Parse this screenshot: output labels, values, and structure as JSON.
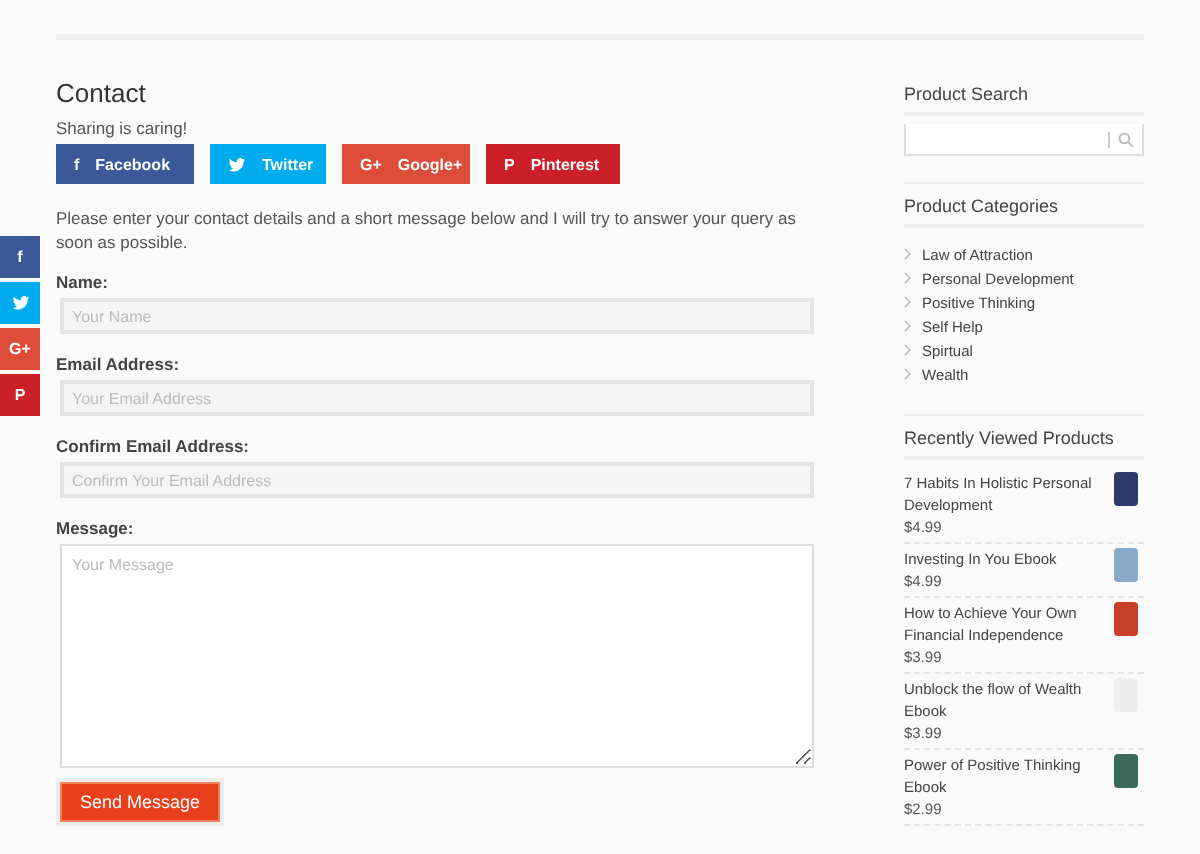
{
  "floating_share": [
    {
      "kind": "facebook",
      "icon": "f",
      "color": "#3b5998"
    },
    {
      "kind": "twitter",
      "color": "#00aced"
    },
    {
      "kind": "googleplus",
      "icon": "G+",
      "color": "#dd4b39"
    },
    {
      "kind": "pinterest",
      "icon": "P",
      "color": "#cb2027"
    }
  ],
  "contact": {
    "title": "Contact",
    "sharing_label": "Sharing is caring!",
    "share_buttons": [
      {
        "kind": "facebook",
        "icon": "f",
        "label": "Facebook",
        "color": "#3b5998"
      },
      {
        "kind": "twitter",
        "label": "Twitter",
        "color": "#00aced"
      },
      {
        "kind": "googleplus",
        "icon": "G+",
        "label": "Google+",
        "color": "#dd4b39"
      },
      {
        "kind": "pinterest",
        "icon": "P",
        "label": "Pinterest",
        "color": "#cb2027"
      }
    ],
    "intro": "Please enter your contact details and a short message below and I will try to answer your query as soon as possible.",
    "fields": [
      {
        "kind": "input",
        "label": "Name:",
        "placeholder": "Your Name"
      },
      {
        "kind": "input",
        "label": "Email Address:",
        "placeholder": "Your Email Address"
      },
      {
        "kind": "input",
        "label": "Confirm Email Address:",
        "placeholder": "Confirm Your Email Address"
      },
      {
        "kind": "textarea",
        "label": "Message:",
        "placeholder": "Your Message"
      }
    ],
    "submit": "Send Message"
  },
  "sidebar": {
    "search_title": "Product Search",
    "categories_title": "Product Categories",
    "categories": [
      "Law of Attraction",
      "Personal Development",
      "Positive Thinking",
      "Self Help",
      "Spirtual",
      "Wealth"
    ],
    "recent_title": "Recently Viewed Products",
    "recent": [
      {
        "name": "7 Habits In Holistic Personal Development",
        "price": "$4.99"
      },
      {
        "name": "Investing In You Ebook",
        "price": "$4.99"
      },
      {
        "name": "How to Achieve Your Own Financial Independence",
        "price": "$3.99"
      },
      {
        "name": "Unblock the flow of Wealth Ebook",
        "price": "$3.99"
      },
      {
        "name": "Power of Positive Thinking Ebook",
        "price": "$2.99"
      }
    ]
  }
}
